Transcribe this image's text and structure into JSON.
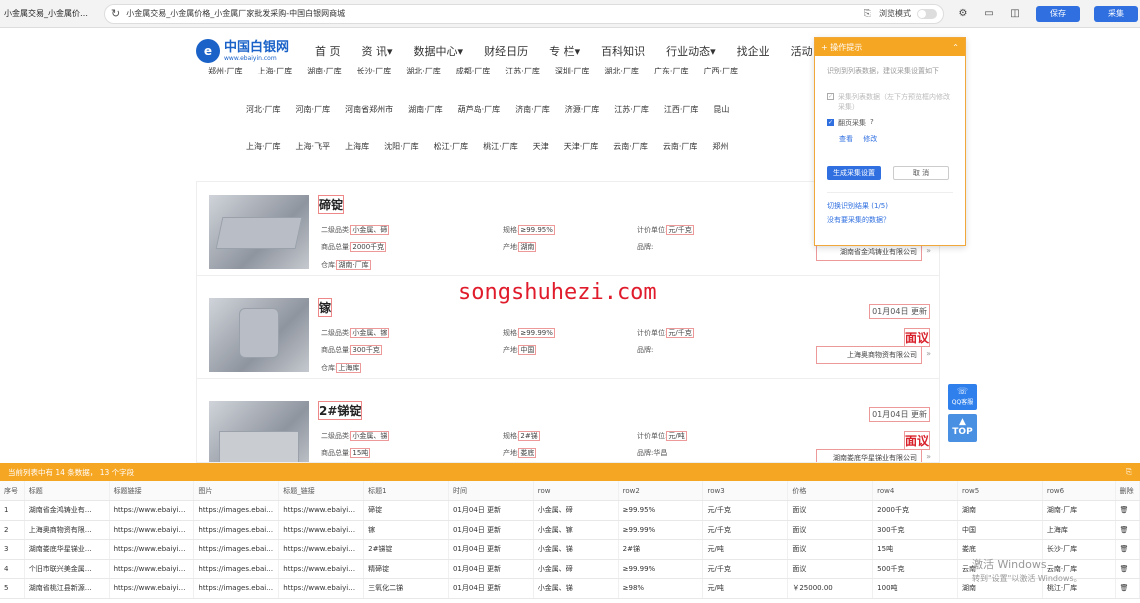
{
  "browser": {
    "tab_title": "小金属交易_小金属价…",
    "url": "小金属交易_小金属价格_小金属厂家批发采购-中国白银网商城",
    "mode_label": "浏览模式",
    "save_label": "保存",
    "collect_label": "采集"
  },
  "site": {
    "logo_name": "中国白银网",
    "logo_domain": "www.ebaiyin.com",
    "nav": [
      "首 页",
      "资 讯▾",
      "数据中心▾",
      "财经日历",
      "专 栏▾",
      "百科知识",
      "行业动态▾",
      "找企业",
      "活动"
    ]
  },
  "warehouses": {
    "row0": [
      "郑州·厂库",
      "上海·厂库",
      "湖南·厂库",
      "长沙·厂库",
      "湖北·厂库",
      "成都·厂库",
      "江苏·厂库",
      "深圳·厂库",
      "湖北·厂库",
      "广东·厂库",
      "广西·厂库"
    ],
    "row1": [
      "河北·厂库",
      "河南·厂库",
      "河南省郑州市",
      "湖南·厂库",
      "葫芦岛·厂库",
      "济南·厂库",
      "济源·厂库",
      "江苏·厂库",
      "江西·厂库",
      "昆山"
    ],
    "row2": [
      "上海·厂库",
      "上海·飞平",
      "上海库",
      "沈阳·厂库",
      "松江·厂库",
      "桃江·厂库",
      "天津",
      "天津·厂库",
      "云南·厂库",
      "云南·厂库",
      "郑州"
    ]
  },
  "products": [
    {
      "title": "碲锭",
      "cat_label": "二级品类:",
      "cat": "小金属、碲",
      "spec_label": "规格:",
      "spec": "≥99.95%",
      "unit_label": "计价单位:",
      "unit": "元/千克",
      "qty_label": "商品总量:",
      "qty": "2000千克",
      "origin_label": "产地:",
      "origin": "湖南",
      "brand_label": "品牌:",
      "brand": "",
      "wh_label": "仓库:",
      "wh": "湖南·厂库",
      "date": "",
      "price": "",
      "company": "湖南省金鸿铸业有限公司"
    },
    {
      "title": "镓",
      "cat_label": "二级品类:",
      "cat": "小金属、镓",
      "spec_label": "规格:",
      "spec": "≥99.99%",
      "unit_label": "计价单位:",
      "unit": "元/千克",
      "qty_label": "商品总量:",
      "qty": "300千克",
      "origin_label": "产地:",
      "origin": "中国",
      "brand_label": "品牌:",
      "brand": "",
      "wh_label": "仓库:",
      "wh": "上海库",
      "date": "01月04日 更新",
      "price": "面议",
      "company": "上海奥商物资有限公司"
    },
    {
      "title": "2#锑锭",
      "cat_label": "二级品类:",
      "cat": "小金属、锑",
      "spec_label": "规格:",
      "spec": "2#锑",
      "unit_label": "计价单位:",
      "unit": "元/吨",
      "qty_label": "商品总量:",
      "qty": "15吨",
      "origin_label": "产地:",
      "origin": "娄底",
      "brand_label": "品牌:",
      "brand": "华昌",
      "wh_label": "",
      "wh": "",
      "date": "01月04日 更新",
      "price": "面议",
      "company": "湖南娄底华星锑业有限公司"
    }
  ],
  "watermark": "songshuhezi.com",
  "side": {
    "qq": "QQ客服",
    "top": "TOP"
  },
  "popup": {
    "title": "+ 操作提示",
    "collapse": "⌃",
    "desc": "识别到列表数据，建议采集设置如下",
    "opt1": "采集列表数据（左下方预览框内修改采集）",
    "opt2": "翻页采集",
    "view": "查看",
    "edit": "修改",
    "generate": "生成采集设置",
    "cancel": "取 消",
    "switch": "切换识别结果 (1/5)",
    "missing": "没有要采集的数据？"
  },
  "panel": {
    "summary": "当前列表中有 14 条数据， 13 个字段",
    "headers": [
      "序号",
      "标题",
      "标题链接",
      "图片",
      "标题_链接",
      "标题1",
      "时间",
      "row",
      "row2",
      "row3",
      "价格",
      "row4",
      "row5",
      "row6",
      "删除"
    ],
    "rows": [
      [
        "1",
        "湖南省金鸿铸业有…",
        "https://www.ebaiyi…",
        "https://images.ebai…",
        "https://www.ebaiyi…",
        "碲锭",
        "01月04日 更新",
        "小金属、碲",
        "≥99.95%",
        "元/千克",
        "面议",
        "2000千克",
        "湖南",
        "湖南·厂库",
        "🗑"
      ],
      [
        "2",
        "上海奥商物资有限…",
        "https://www.ebaiyi…",
        "https://images.ebai…",
        "https://www.ebaiyi…",
        "镓",
        "01月04日 更新",
        "小金属、镓",
        "≥99.99%",
        "元/千克",
        "面议",
        "300千克",
        "中国",
        "上海库",
        "🗑"
      ],
      [
        "3",
        "湖南娄底华星锑业…",
        "https://www.ebaiyi…",
        "https://images.ebai…",
        "https://www.ebaiyi…",
        "2#锑锭",
        "01月04日 更新",
        "小金属、锑",
        "2#锑",
        "元/吨",
        "面议",
        "15吨",
        "娄底",
        "长沙·厂库",
        "🗑"
      ],
      [
        "4",
        "个旧市联兴美金属…",
        "https://www.ebaiyi…",
        "https://images.ebai…",
        "https://www.ebaiyi…",
        "精碲锭",
        "01月04日 更新",
        "小金属、碲",
        "≥99.99%",
        "元/千克",
        "面议",
        "500千克",
        "云南",
        "云南·厂库",
        "🗑"
      ],
      [
        "5",
        "湖南省桃江县新源…",
        "https://www.ebaiyi…",
        "https://images.ebai…",
        "https://www.ebaiyi…",
        "三氧化二锑",
        "01月04日 更新",
        "小金属、锑",
        "≥98%",
        "元/吨",
        "￥25000.00",
        "100吨",
        "湖南",
        "桃江·厂库",
        "🗑"
      ]
    ]
  },
  "os": {
    "activate": "激活 Windows",
    "activate_sub": "转到\"设置\"以激活 Windows。"
  }
}
